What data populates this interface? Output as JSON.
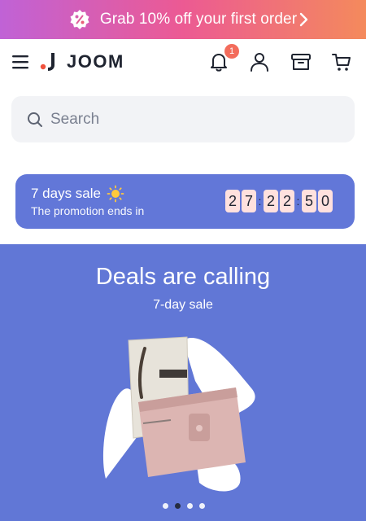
{
  "promo": {
    "text": "Grab 10% off your first order",
    "badge_icon": "percent-badge-icon",
    "chevron_icon": "chevron-right-icon"
  },
  "header": {
    "logo_text": "JOOM",
    "notification_count": "1",
    "icons": [
      "menu-icon",
      "bell-icon",
      "user-icon",
      "archive-box-icon",
      "cart-icon"
    ]
  },
  "search": {
    "placeholder": "Search"
  },
  "sale": {
    "title": "7 days sale",
    "subtitle": "The promotion ends in",
    "timer_digits": [
      "2",
      "7",
      "2",
      "2",
      "5",
      "0"
    ]
  },
  "hero": {
    "title": "Deals are calling",
    "subtitle": "7-day sale",
    "slides": 4,
    "active_slide": 1
  },
  "colors": {
    "promo_gradient": [
      "#c062d6",
      "#ec5a93",
      "#f48a5c"
    ],
    "sale_banner": "#6277d8",
    "hero_bg": "#6177d6",
    "timer_digit_bg": "#ffe1de",
    "badge": "#f36c5c"
  }
}
